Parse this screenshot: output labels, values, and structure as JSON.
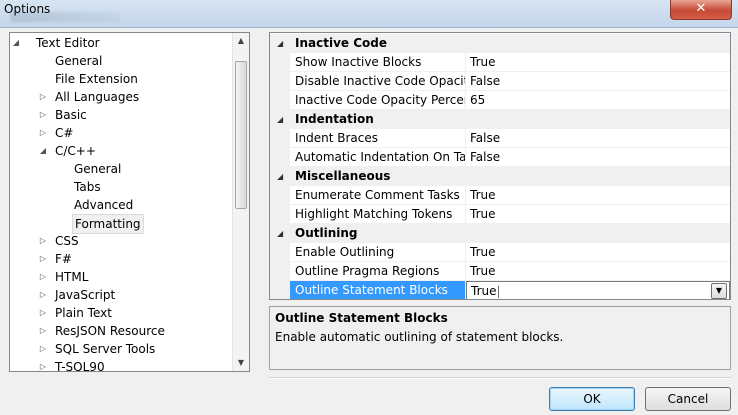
{
  "window": {
    "title": "Options",
    "close_glyph": "✕"
  },
  "tree": {
    "items": [
      {
        "label": "Text Editor",
        "level": 0,
        "expander": "expanded"
      },
      {
        "label": "General",
        "level": 1,
        "expander": "none"
      },
      {
        "label": "File Extension",
        "level": 1,
        "expander": "none"
      },
      {
        "label": "All Languages",
        "level": 1,
        "expander": "collapsed"
      },
      {
        "label": "Basic",
        "level": 1,
        "expander": "collapsed"
      },
      {
        "label": "C#",
        "level": 1,
        "expander": "collapsed"
      },
      {
        "label": "C/C++",
        "level": 1,
        "expander": "expanded"
      },
      {
        "label": "General",
        "level": 2,
        "expander": "none"
      },
      {
        "label": "Tabs",
        "level": 2,
        "expander": "none"
      },
      {
        "label": "Advanced",
        "level": 2,
        "expander": "none"
      },
      {
        "label": "Formatting",
        "level": 2,
        "expander": "none",
        "selected": true
      },
      {
        "label": "CSS",
        "level": 1,
        "expander": "collapsed"
      },
      {
        "label": "F#",
        "level": 1,
        "expander": "collapsed"
      },
      {
        "label": "HTML",
        "level": 1,
        "expander": "collapsed"
      },
      {
        "label": "JavaScript",
        "level": 1,
        "expander": "collapsed"
      },
      {
        "label": "Plain Text",
        "level": 1,
        "expander": "collapsed"
      },
      {
        "label": "ResJSON Resource",
        "level": 1,
        "expander": "collapsed"
      },
      {
        "label": "SQL Server Tools",
        "level": 1,
        "expander": "collapsed"
      },
      {
        "label": "T-SQL90",
        "level": 1,
        "expander": "collapsed"
      }
    ]
  },
  "grid": {
    "categories": [
      {
        "name": "Inactive Code",
        "rows": [
          {
            "name": "Show Inactive Blocks",
            "value": "True"
          },
          {
            "name": "Disable Inactive Code Opacity",
            "value": "False"
          },
          {
            "name": "Inactive Code Opacity Percent",
            "value": "65"
          }
        ]
      },
      {
        "name": "Indentation",
        "rows": [
          {
            "name": "Indent Braces",
            "value": "False"
          },
          {
            "name": "Automatic Indentation On Tab",
            "value": "False"
          }
        ]
      },
      {
        "name": "Miscellaneous",
        "rows": [
          {
            "name": "Enumerate Comment Tasks",
            "value": "True"
          },
          {
            "name": "Highlight Matching Tokens",
            "value": "True"
          }
        ]
      },
      {
        "name": "Outlining",
        "rows": [
          {
            "name": "Enable Outlining",
            "value": "True"
          },
          {
            "name": "Outline Pragma Regions",
            "value": "True"
          },
          {
            "name": "Outline Statement Blocks",
            "value": "True",
            "selected": true
          }
        ]
      }
    ]
  },
  "description": {
    "title": "Outline Statement Blocks",
    "text": "Enable automatic outlining of statement blocks."
  },
  "buttons": {
    "ok": "OK",
    "cancel": "Cancel"
  }
}
